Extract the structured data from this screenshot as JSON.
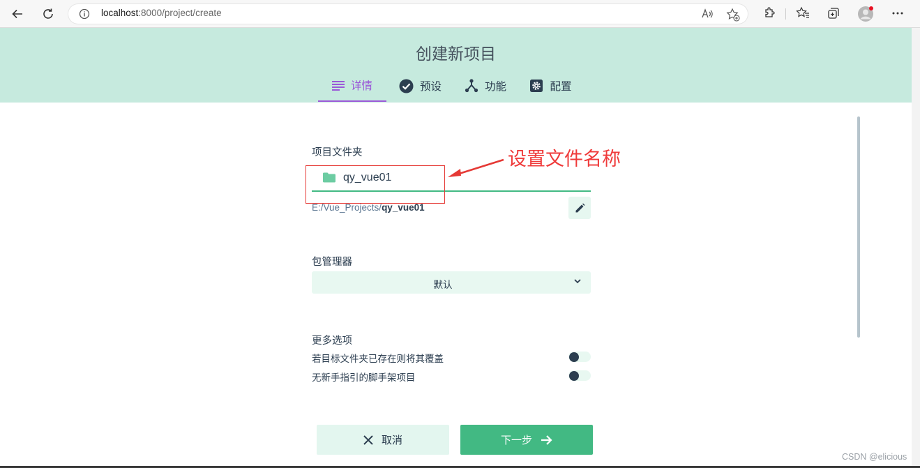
{
  "browser": {
    "url_host": "localhost",
    "url_rest": ":8000/project/create"
  },
  "app": {
    "title": "创建新项目",
    "tabs": [
      {
        "label": "详情",
        "icon": "list-icon",
        "active": true
      },
      {
        "label": "预设",
        "icon": "check-circle-icon",
        "active": false
      },
      {
        "label": "功能",
        "icon": "fork-icon",
        "active": false
      },
      {
        "label": "配置",
        "icon": "gear-icon",
        "active": false
      }
    ]
  },
  "form": {
    "folder_label": "项目文件夹",
    "folder_value": "qy_vue01",
    "path_prefix": "E:/Vue_Projects/",
    "path_name": "qy_vue01",
    "package_manager_label": "包管理器",
    "package_manager_value": "默认",
    "more_options_label": "更多选项",
    "options": [
      {
        "label": "若目标文件夹已存在则将其覆盖",
        "enabled": false
      },
      {
        "label": "无新手指引的脚手架项目",
        "enabled": false
      }
    ],
    "cancel_label": "取消",
    "next_label": "下一步"
  },
  "annotation": {
    "text": "设置文件名称",
    "color": "#ef3a3a"
  },
  "watermark": "CSDN @elicious",
  "colors": {
    "accent": "#42b983",
    "header_bg": "#c6eade",
    "active_tab": "#9b59d8"
  }
}
